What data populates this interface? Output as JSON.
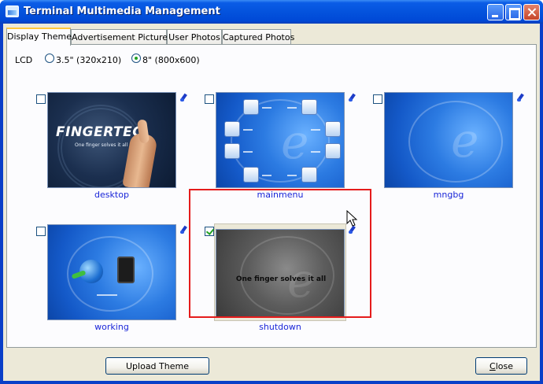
{
  "window": {
    "title": "Terminal Multimedia Management"
  },
  "tabs": [
    {
      "label": "Display Theme",
      "active": true
    },
    {
      "label": "Advertisement Pictures",
      "active": false
    },
    {
      "label": "User Photos",
      "active": false
    },
    {
      "label": "Captured Photos",
      "active": false
    }
  ],
  "lcd": {
    "label": "LCD",
    "options": [
      {
        "label": "3.5\" (320x210)",
        "selected": false
      },
      {
        "label": "8\" (800x600)",
        "selected": true
      }
    ]
  },
  "themes": [
    {
      "name": "desktop",
      "checked": false,
      "image_text": "FINGERTEC",
      "image_tagline": "One finger solves it all"
    },
    {
      "name": "mainmenu",
      "checked": false
    },
    {
      "name": "mngbg",
      "checked": false
    },
    {
      "name": "working",
      "checked": false
    },
    {
      "name": "shutdown",
      "checked": true,
      "image_text": "One finger solves it all"
    }
  ],
  "buttons": {
    "upload": "Upload Theme",
    "close_accel": "C",
    "close_rest": "lose"
  },
  "colors": {
    "title_bar": "#0453dd",
    "highlight": "#e51c1c",
    "thumb_label": "#1a26d8",
    "check": "#21a121"
  },
  "icons": [
    "window-app-icon",
    "minimize-icon",
    "maximize-icon",
    "close-icon",
    "edit-icon",
    "cursor-icon"
  ]
}
